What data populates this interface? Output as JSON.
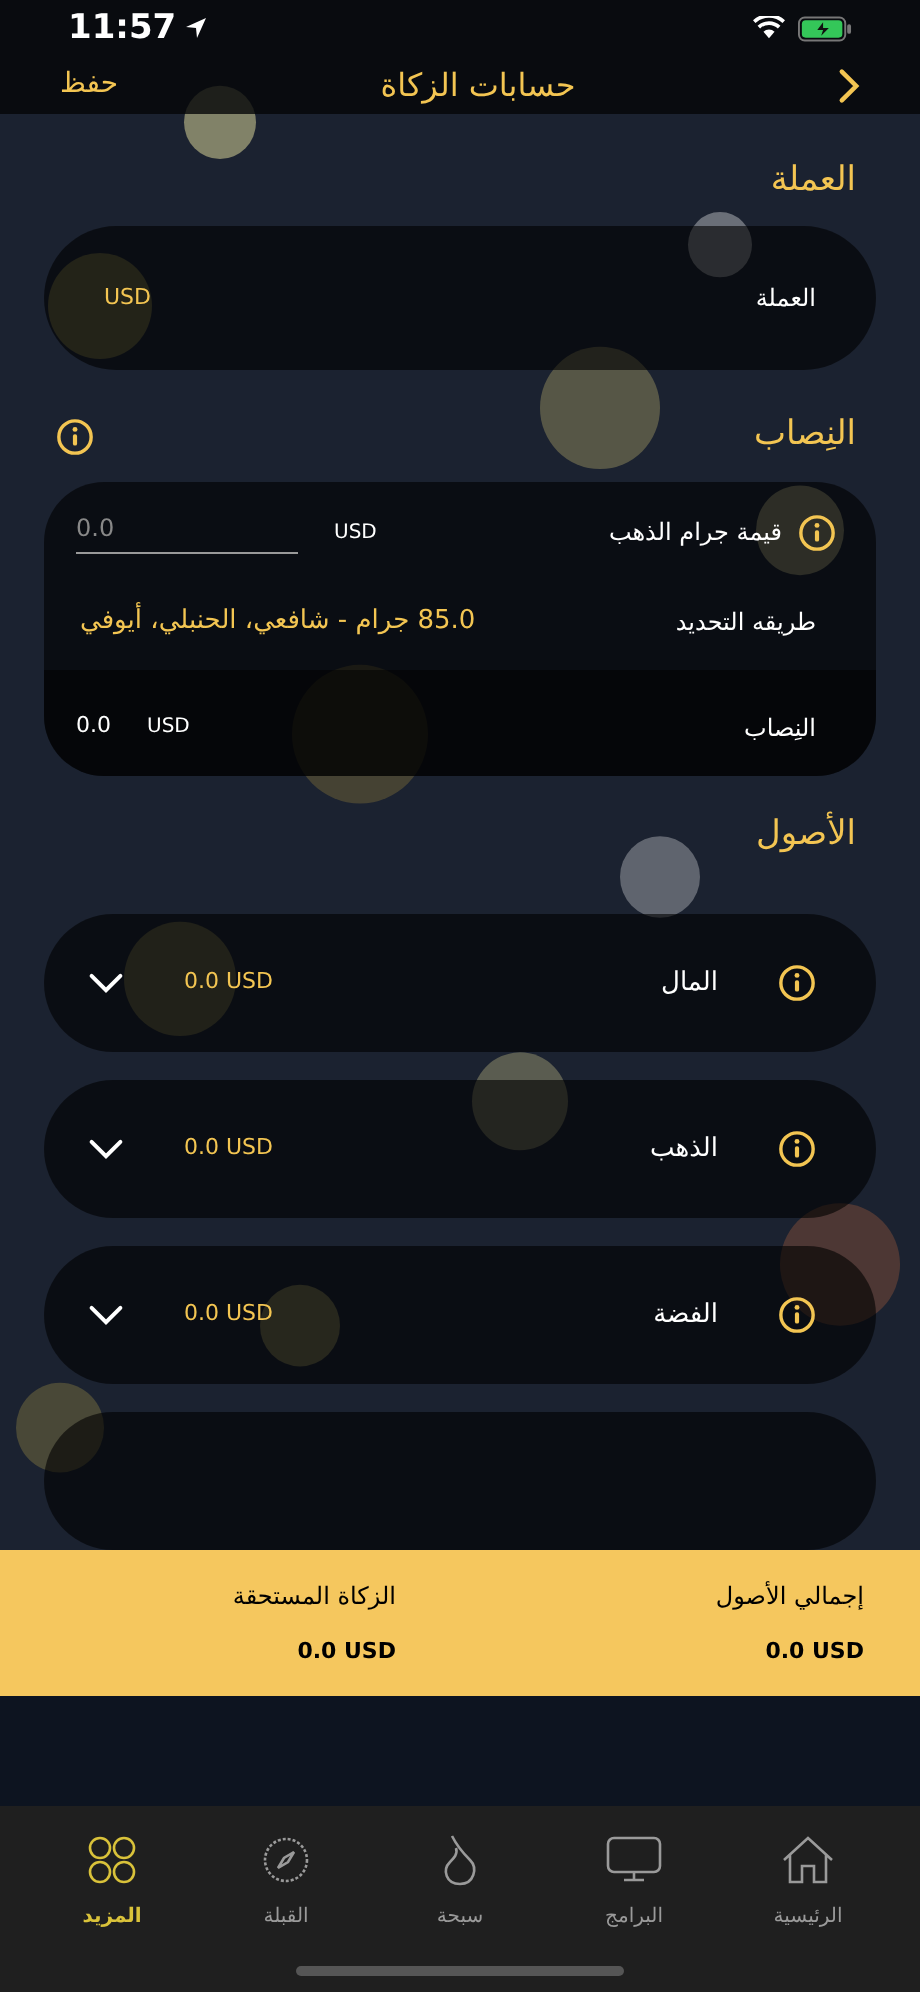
{
  "status_bar": {
    "time": "11:57"
  },
  "nav": {
    "title": "حسابات الزكاة",
    "save": "حفظ"
  },
  "currency_section": {
    "title": "العملة",
    "label": "العملة",
    "value": "USD"
  },
  "nisab_section": {
    "title": "النِصاب",
    "gold_gram_label": "قيمة جرام الذهب",
    "gold_gram_currency": "USD",
    "gold_gram_placeholder": "0.0",
    "method_label": "طريقه التحديد",
    "method_value": "85.0 جرام - شافعي، الحنبلي، أيوفي",
    "nisab_label": "النِصاب",
    "nisab_currency": "USD",
    "nisab_value": "0.0"
  },
  "assets_section": {
    "title": "الأصول",
    "items": [
      {
        "name": "المال",
        "amount": "0.0 USD",
        "expanded": false
      },
      {
        "name": "الذهب",
        "amount": "0.0 USD",
        "expanded": false
      },
      {
        "name": "الفضة",
        "amount": "0.0 USD",
        "expanded": false
      }
    ]
  },
  "summary": {
    "total_assets_label": "إجمالي الأصول",
    "total_assets": "0.0 USD",
    "zakat_due_label": "الزكاة المستحقة",
    "zakat_due": "0.0 USD"
  },
  "tab_bar": [
    {
      "kind": "home",
      "label": "الرئيسية",
      "selected": false
    },
    {
      "kind": "screen",
      "label": "البرامج",
      "selected": false
    },
    {
      "kind": "drop",
      "label": "سبحة",
      "selected": false
    },
    {
      "kind": "compass",
      "label": "القبلة",
      "selected": false
    },
    {
      "kind": "grid",
      "label": "المزيد",
      "selected": true
    }
  ]
}
